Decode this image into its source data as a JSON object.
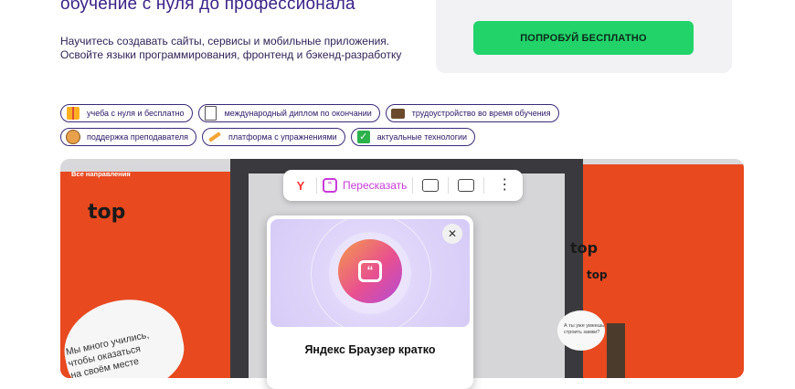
{
  "hero": {
    "heading": "обучение с нуля до профессионала",
    "description_line1": "Научитесь создавать сайты, сервисы и мобильные приложения.",
    "description_line2": "Освойте языки программирования, фронтенд и бэкенд-разработку"
  },
  "cta": {
    "button_label": "ПОПРОБУЙ БЕСПЛАТНО",
    "accent": "#22d36a"
  },
  "tags": [
    {
      "label": "учеба с нуля и бесплатно",
      "icon": "gift-icon"
    },
    {
      "label": "международный диплом по окончании",
      "icon": "document-icon"
    },
    {
      "label": "трудоустройство во время обучения",
      "icon": "briefcase-icon"
    },
    {
      "label": "поддержка преподавателя",
      "icon": "face-icon"
    },
    {
      "label": "платформа с упражнениями",
      "icon": "pencil-icon"
    },
    {
      "label": "актуальные технологии",
      "icon": "checkmark-icon"
    }
  ],
  "video": {
    "corner_label": "Все направления",
    "logo_text": "top",
    "bubble_left_line1": "Мы много учились,",
    "bubble_left_line2": "чтобы оказаться",
    "bubble_left_line3": "на своём месте",
    "bubble_right_line1": "А ты уже умеешь",
    "bubble_right_line2": "строить замки?"
  },
  "toolbar": {
    "retell_label": "Пересказать"
  },
  "popup": {
    "title": "Яндекс Браузер кратко"
  }
}
